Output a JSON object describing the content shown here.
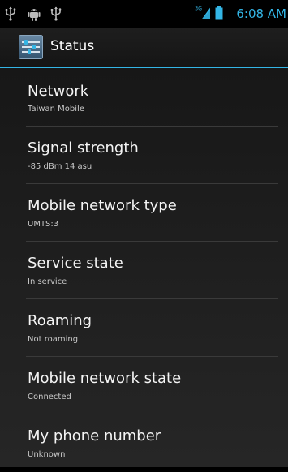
{
  "status_bar": {
    "icons": [
      "usb-icon",
      "android-debug-icon",
      "usb-icon",
      "3g-signal-icon",
      "battery-icon"
    ],
    "network_badge": "3G",
    "time": "6:08 AM",
    "accent": "#33b5e5"
  },
  "action_bar": {
    "icon": "settings-icon",
    "title": "Status"
  },
  "items": [
    {
      "title": "Network",
      "value": "Taiwan Mobile"
    },
    {
      "title": "Signal strength",
      "value": "-85 dBm   14 asu"
    },
    {
      "title": "Mobile network type",
      "value": "UMTS:3"
    },
    {
      "title": "Service state",
      "value": "In service"
    },
    {
      "title": "Roaming",
      "value": "Not roaming"
    },
    {
      "title": "Mobile network state",
      "value": "Connected"
    },
    {
      "title": "My phone number",
      "value": "Unknown"
    }
  ]
}
